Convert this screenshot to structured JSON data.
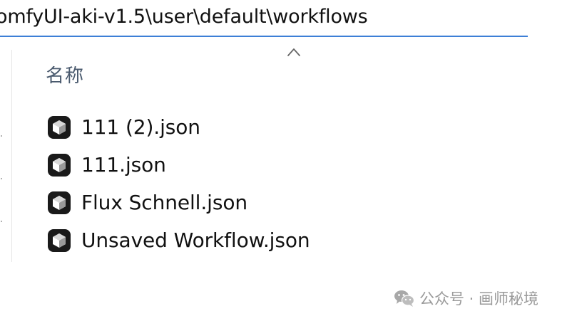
{
  "address_bar": {
    "path": "omfyUI-aki-v1.5\\user\\default\\workflows"
  },
  "header": {
    "sort_icon": "chevron-up-icon",
    "name_column_label": "名称"
  },
  "files": [
    {
      "name": "111 (2).json",
      "icon": "comfyui-file-icon"
    },
    {
      "name": "111.json",
      "icon": "comfyui-file-icon"
    },
    {
      "name": "Flux Schnell.json",
      "icon": "comfyui-file-icon"
    },
    {
      "name": "Unsaved Workflow.json",
      "icon": "comfyui-file-icon"
    }
  ],
  "watermark": {
    "icon": "wechat-icon",
    "text": "公众号 · 画师秘境"
  },
  "colors": {
    "address_underline": "#3d7fd6",
    "header_text": "#4a5a6e",
    "watermark_text": "#9a9a9a",
    "file_icon_bg": "#1a1a1a"
  }
}
